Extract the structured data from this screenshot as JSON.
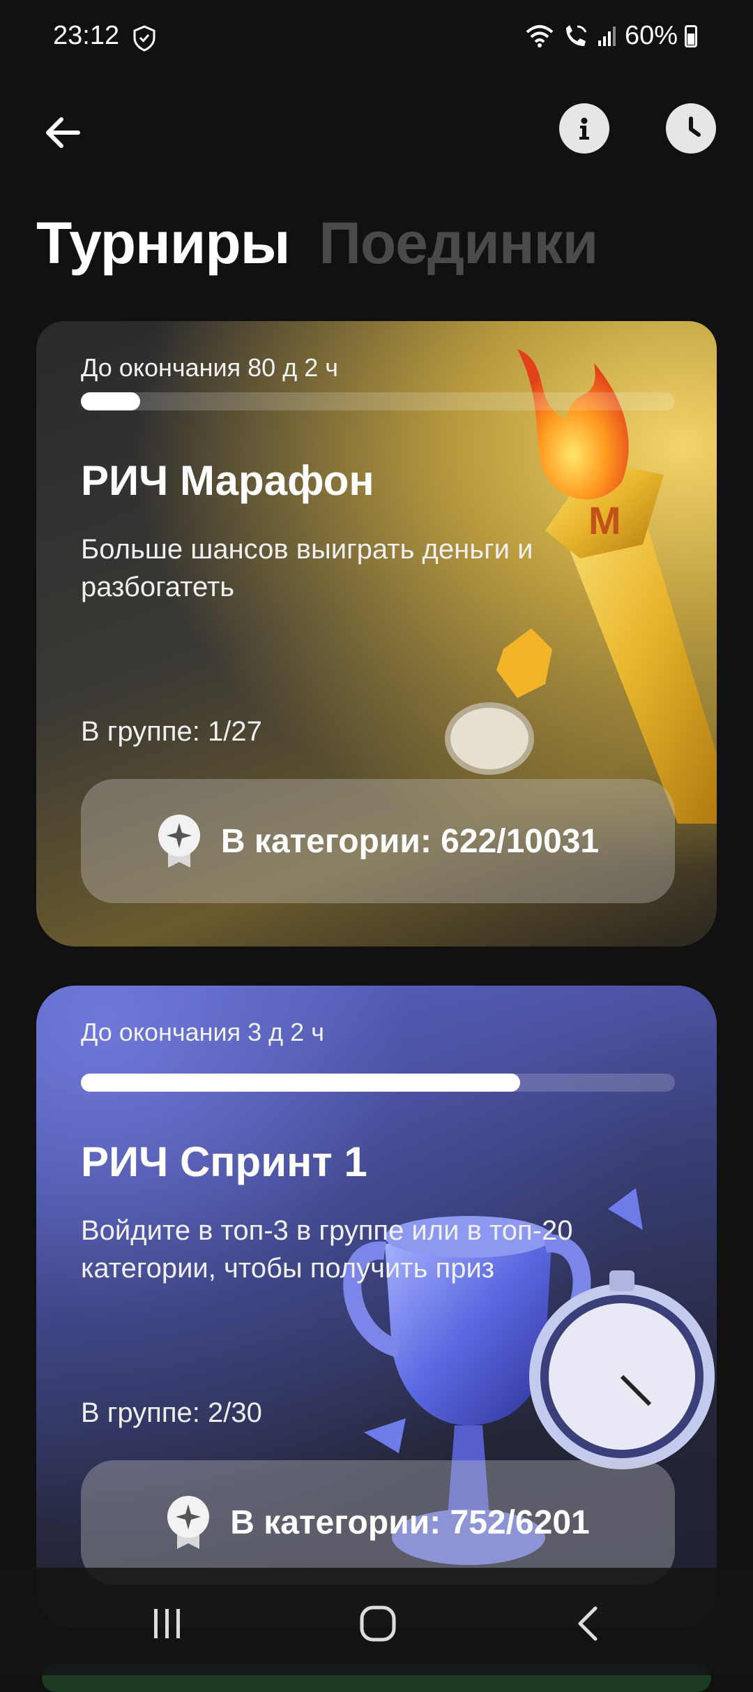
{
  "status": {
    "time": "23:12",
    "battery": "60%"
  },
  "tabs": [
    {
      "label": "Турниры",
      "active": true
    },
    {
      "label": "Поединки",
      "active": false
    }
  ],
  "cards": [
    {
      "deadline": "До окончания 80 д 2 ч",
      "progress": 0.1,
      "title": "РИЧ Марафон",
      "description": "Больше шансов выиграть деньги и разбогатеть",
      "group": "В группе: 1/27",
      "category": "В категории: 622/10031"
    },
    {
      "deadline": "До окончания 3 д 2 ч",
      "progress": 0.74,
      "title": "РИЧ Спринт 1",
      "description": "Войдите в топ-3 в группе или в топ-20 категории, чтобы получить приз",
      "group": "В группе: 2/30",
      "category": "В категории: 752/6201"
    }
  ],
  "icons": {
    "back": "arrow-left-icon",
    "info": "info-icon",
    "history": "clock-icon"
  }
}
